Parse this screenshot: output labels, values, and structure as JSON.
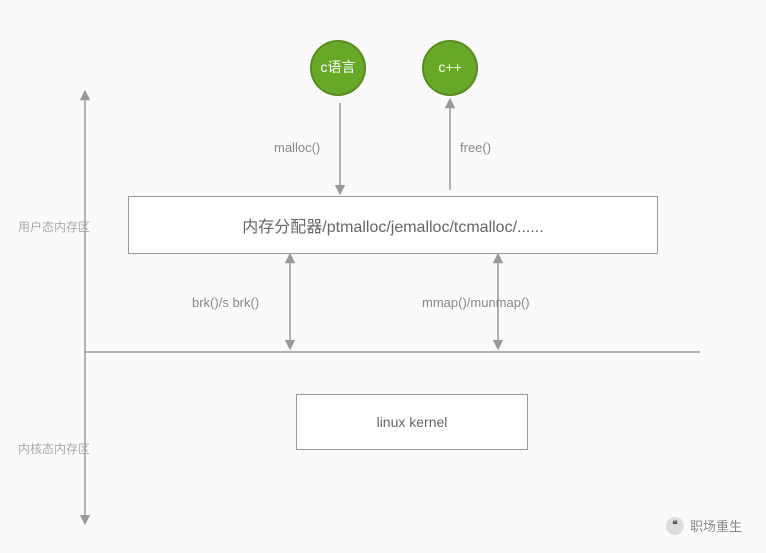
{
  "colors": {
    "green": "#67a827",
    "greenBorder": "#578c20"
  },
  "circles": {
    "c_lang": "c语言",
    "cpp": "c++"
  },
  "arrows": {
    "malloc": "malloc()",
    "free": "free()",
    "brk": "brk()/s brk()",
    "mmap": "mmap()/munmap()"
  },
  "boxes": {
    "allocator": "内存分配器/ptmalloc/jemalloc/tcmalloc/......",
    "kernel": "linux kernel"
  },
  "zones": {
    "user": "用户态内存区",
    "kernel": "内核态内存区"
  },
  "watermark": "职场重生"
}
